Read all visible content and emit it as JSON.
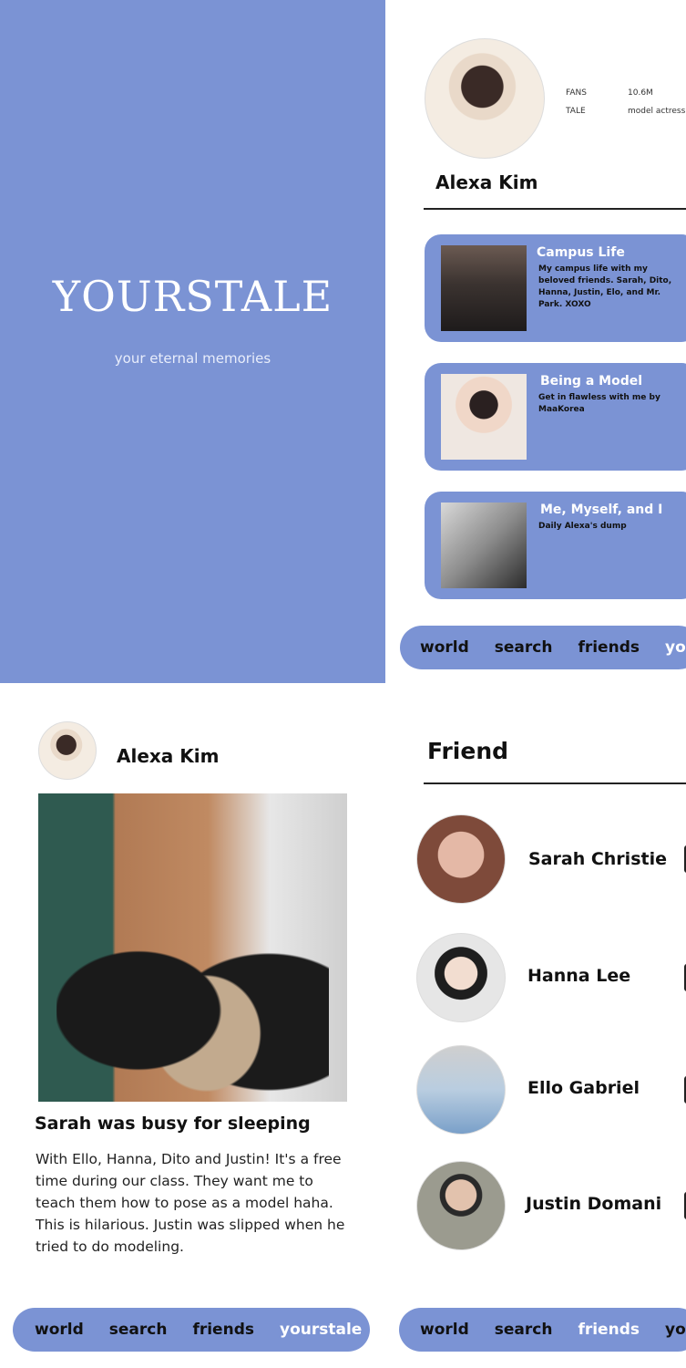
{
  "splash": {
    "brand": "YOURSTALE",
    "tagline": "your eternal memories"
  },
  "profile": {
    "name": "Alexa Kim",
    "stats": [
      {
        "label": "FANS",
        "value": "10.6M"
      },
      {
        "label": "TALE",
        "value": "model actress l"
      }
    ],
    "tales": [
      {
        "title": "Campus Life",
        "desc": "My campus life with my beloved friends. Sarah, Dito, Hanna, Justin, Elo, and Mr. Park. XOXO"
      },
      {
        "title": "Being a Model",
        "desc": "Get in flawless with me by MaaKorea"
      },
      {
        "title": "Me, Myself, and I",
        "desc": "Daily Alexa's dump"
      }
    ]
  },
  "nav_profile": [
    "world",
    "search",
    "friends",
    "you"
  ],
  "post": {
    "author": "Alexa Kim",
    "title": "Sarah was busy for sleeping",
    "body": "With Ello, Hanna, Dito and Justin! It's a free time during our class. They want me to teach them how to pose as a model haha. This is hilarious. Justin was slipped when he tried to do modeling."
  },
  "nav_post": [
    "world",
    "search",
    "friends",
    "yourstale"
  ],
  "friends": {
    "title": "Friend",
    "list": [
      {
        "name": "Sarah Christie"
      },
      {
        "name": "Hanna Lee"
      },
      {
        "name": "Ello Gabriel"
      },
      {
        "name": "Justin Domani"
      }
    ]
  },
  "nav_friends": [
    "world",
    "search",
    "friends",
    "you"
  ],
  "colors": {
    "accent": "#7b93d4",
    "active_nav_text": "#ffffff"
  }
}
